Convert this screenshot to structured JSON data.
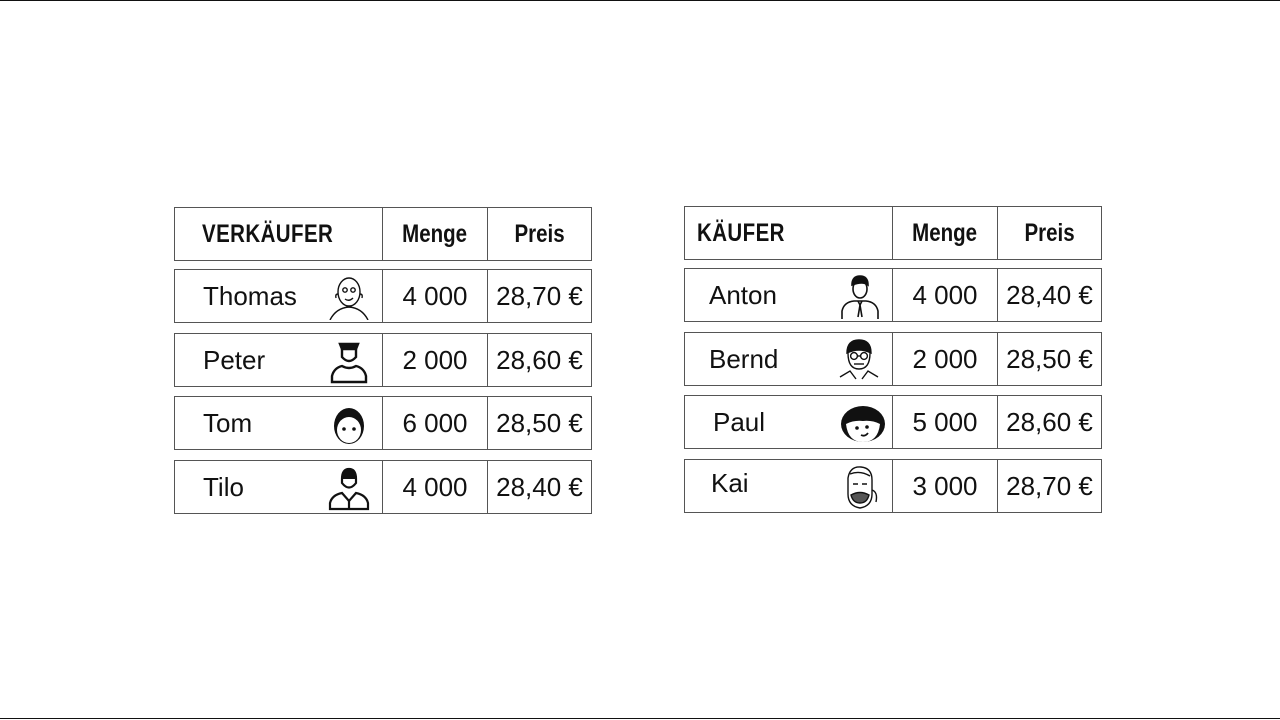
{
  "sellers": {
    "header": {
      "name": "VERKÄUFER",
      "quantity": "Menge",
      "price": "Preis"
    },
    "rows": [
      {
        "name": "Thomas",
        "quantity": "4 000",
        "price": "28,70 €",
        "icon": "bald-man-face-icon"
      },
      {
        "name": "Peter",
        "quantity": "2 000",
        "price": "28,60 €",
        "icon": "man-with-cap-icon"
      },
      {
        "name": "Tom",
        "quantity": "6 000",
        "price": "28,50 €",
        "icon": "man-face-icon"
      },
      {
        "name": "Tilo",
        "quantity": "4 000",
        "price": "28,40 €",
        "icon": "businessman-icon"
      }
    ]
  },
  "buyers": {
    "header": {
      "name": "KÄUFER",
      "quantity": "Menge",
      "price": "Preis"
    },
    "rows": [
      {
        "name": "Anton",
        "quantity": "4 000",
        "price": "28,40 €",
        "icon": "man-with-tie-icon"
      },
      {
        "name": "Bernd",
        "quantity": "2 000",
        "price": "28,50 €",
        "icon": "man-with-glasses-icon"
      },
      {
        "name": "Paul",
        "quantity": "5 000",
        "price": "28,60 €",
        "icon": "boy-face-icon"
      },
      {
        "name": "Kai",
        "quantity": "3 000",
        "price": "28,70 €",
        "icon": "bearded-man-icon"
      }
    ]
  }
}
